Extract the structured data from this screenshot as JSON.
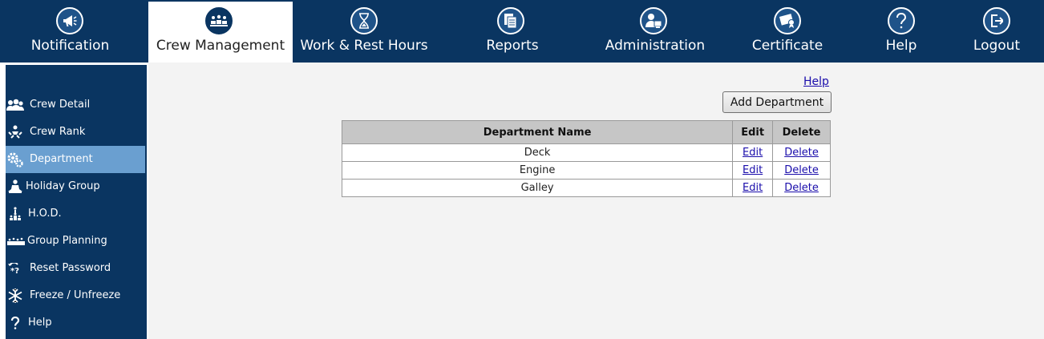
{
  "topnav": {
    "items": [
      {
        "label": "Notification",
        "icon": "megaphone-icon"
      },
      {
        "label": "Crew Management",
        "icon": "crew-group-icon",
        "active": true
      },
      {
        "label": "Work & Rest Hours",
        "icon": "hourglass-icon"
      },
      {
        "label": "Reports",
        "icon": "documents-icon"
      },
      {
        "label": "Administration",
        "icon": "admin-user-icon"
      },
      {
        "label": "Certificate",
        "icon": "certificate-icon"
      },
      {
        "label": "Help",
        "icon": "question-icon"
      },
      {
        "label": "Logout",
        "icon": "logout-icon"
      }
    ]
  },
  "sidebar": {
    "items": [
      {
        "label": "Crew Detail",
        "icon": "people-icon"
      },
      {
        "label": "Crew Rank",
        "icon": "rank-icon"
      },
      {
        "label": "Department",
        "icon": "gears-icon",
        "active": true
      },
      {
        "label": "Holiday Group",
        "icon": "meditation-icon"
      },
      {
        "label": "H.O.D.",
        "icon": "hierarchy-icon"
      },
      {
        "label": "Group Planning",
        "icon": "group-planning-icon"
      },
      {
        "label": "Reset Password",
        "icon": "reset-password-icon"
      },
      {
        "label": "Freeze / Unfreeze",
        "icon": "snowflake-icon"
      },
      {
        "label": "Help",
        "icon": "question-icon"
      }
    ]
  },
  "main": {
    "help_link": "Help",
    "add_button": "Add Department",
    "table": {
      "headers": [
        "Department Name",
        "Edit",
        "Delete"
      ],
      "rows": [
        {
          "name": "Deck",
          "edit": "Edit",
          "delete": "Delete"
        },
        {
          "name": "Engine",
          "edit": "Edit",
          "delete": "Delete"
        },
        {
          "name": "Galley",
          "edit": "Edit",
          "delete": "Delete"
        }
      ]
    }
  },
  "colors": {
    "nav_bg": "#0a3561",
    "active_side": "#6a9fd0",
    "link": "#1a0dab",
    "table_header": "#c6c6c6"
  }
}
